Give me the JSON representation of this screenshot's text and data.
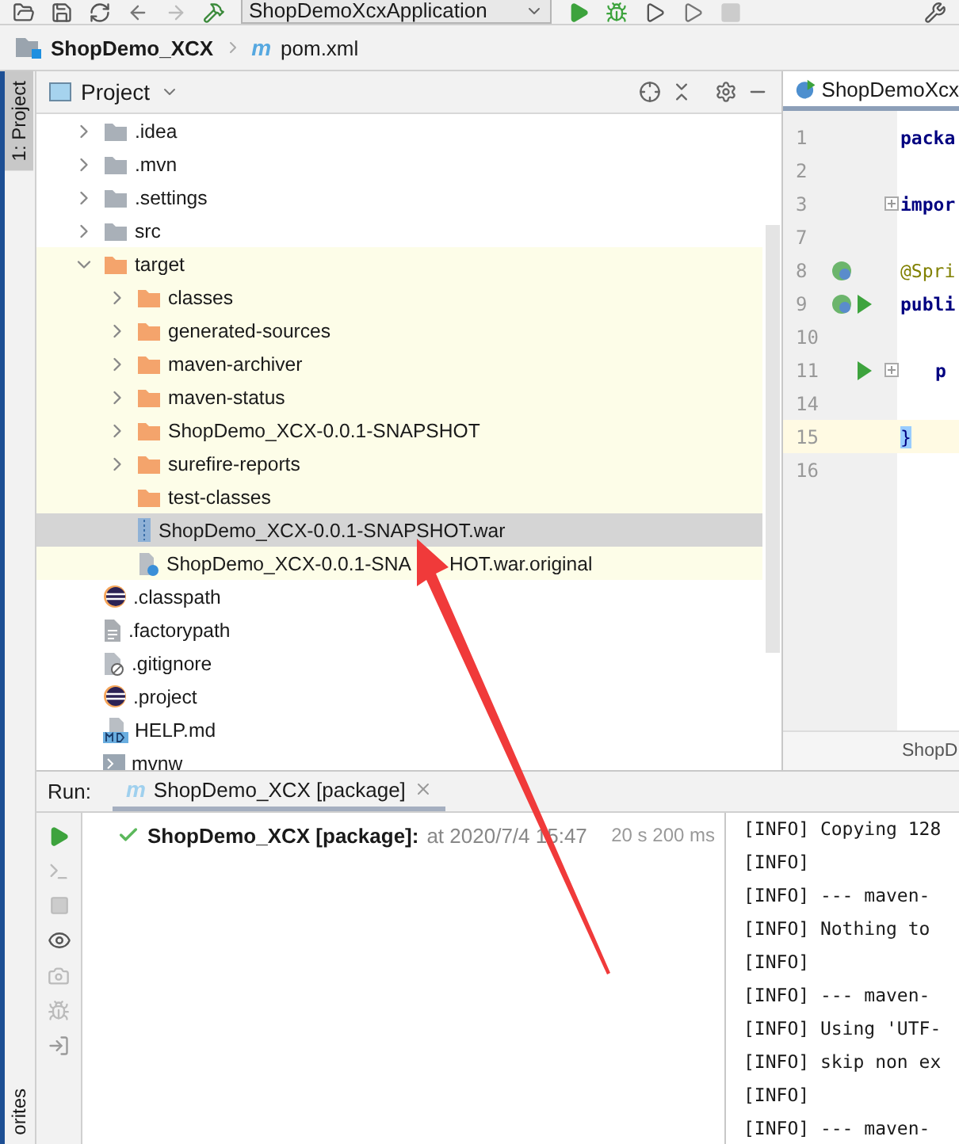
{
  "toolbar": {
    "run_config": "ShopDemoXcxApplication"
  },
  "breadcrumb": [
    {
      "label": "ShopDemo_XCX",
      "kind": "project"
    },
    {
      "label": "pom.xml",
      "kind": "maven",
      "icon": "m"
    }
  ],
  "side_tabs": {
    "top": [
      {
        "label": "1: Project",
        "selected": true
      }
    ],
    "bottom": [
      {
        "label": "orites",
        "selected": false
      }
    ]
  },
  "project": {
    "title": "Project",
    "tree": [
      {
        "label": ".idea",
        "kind": "folder",
        "expanded": false,
        "excluded": false,
        "selected": false
      },
      {
        "label": ".mvn",
        "kind": "folder",
        "expanded": false,
        "excluded": false,
        "selected": false
      },
      {
        "label": ".settings",
        "kind": "folder",
        "expanded": false,
        "excluded": false,
        "selected": false
      },
      {
        "label": "src",
        "kind": "folder",
        "expanded": false,
        "excluded": false,
        "selected": false
      },
      {
        "label": "target",
        "kind": "folder",
        "expanded": true,
        "excluded": true,
        "selected": false,
        "children": [
          {
            "label": "classes",
            "kind": "folder",
            "expanded": false,
            "selected": false
          },
          {
            "label": "generated-sources",
            "kind": "folder",
            "expanded": false,
            "selected": false
          },
          {
            "label": "maven-archiver",
            "kind": "folder",
            "expanded": false,
            "selected": false
          },
          {
            "label": "maven-status",
            "kind": "folder",
            "expanded": false,
            "selected": false
          },
          {
            "label": "ShopDemo_XCX-0.0.1-SNAPSHOT",
            "kind": "folder",
            "expanded": false,
            "selected": false
          },
          {
            "label": "surefire-reports",
            "kind": "folder",
            "expanded": false,
            "selected": false
          },
          {
            "label": "test-classes",
            "kind": "leaf-folder",
            "selected": false
          },
          {
            "label": "ShopDemo_XCX-0.0.1-SNAPSHOT.war",
            "kind": "archive",
            "selected": true
          },
          {
            "label_parts": [
              "ShopDemo_XCX-0.0.1-SNA",
              "HOT.war.original"
            ],
            "kind": "unknown",
            "selected": false
          }
        ]
      },
      {
        "label": ".classpath",
        "kind": "eclipse",
        "excluded": false,
        "selected": false
      },
      {
        "label": ".factorypath",
        "kind": "text",
        "excluded": false,
        "selected": false
      },
      {
        "label": ".gitignore",
        "kind": "ignore",
        "excluded": false,
        "selected": false
      },
      {
        "label": ".project",
        "kind": "eclipse",
        "excluded": false,
        "selected": false
      },
      {
        "label": "HELP.md",
        "kind": "markdown",
        "excluded": false,
        "selected": false
      },
      {
        "label": "mvnw",
        "kind": "script",
        "excluded": false,
        "selected": false
      }
    ]
  },
  "editor": {
    "tab": "ShopDemoXcx",
    "footer": "ShopD",
    "lines": [
      {
        "number": "1",
        "code": "packa",
        "kind": "keyword",
        "fold": false,
        "current": false
      },
      {
        "number": "2",
        "fold": false,
        "current": false
      },
      {
        "number": "3",
        "code": "impor",
        "kind": "keyword",
        "fold": true,
        "current": false
      },
      {
        "number": "7",
        "fold": false,
        "current": false
      },
      {
        "number": "8",
        "code": "@Spri",
        "kind": "annotation",
        "bean": true,
        "run": false,
        "fold": false,
        "current": false
      },
      {
        "number": "9",
        "code": "publi",
        "kind": "keyword",
        "bean": true,
        "run": true,
        "fold": false,
        "current": false
      },
      {
        "number": "10",
        "fold": false,
        "current": false
      },
      {
        "number": "11",
        "code": "p",
        "kind": "keyword",
        "indented": true,
        "bean": false,
        "run": true,
        "fold": true,
        "current": false
      },
      {
        "number": "14",
        "fold": false,
        "current": false
      },
      {
        "number": "15",
        "code": "}",
        "kind": "brace",
        "fold": false,
        "current": true
      },
      {
        "number": "16",
        "fold": false,
        "current": false
      }
    ]
  },
  "run": {
    "label": "Run:",
    "tab_icon": "m",
    "tab": "ShopDemo_XCX [package]",
    "result": {
      "passed": true,
      "name": "ShopDemo_XCX [package]:",
      "time": "at 2020/7/4 15:47",
      "duration": "20 s 200 ms"
    },
    "console": [
      "[INFO] Copying 128",
      "[INFO]",
      "[INFO] --- maven-",
      "[INFO] Nothing to",
      "[INFO]",
      "[INFO] --- maven-",
      "[INFO] Using 'UTF-",
      "[INFO] skip non ex",
      "[INFO]",
      "[INFO] --- maven-"
    ]
  }
}
